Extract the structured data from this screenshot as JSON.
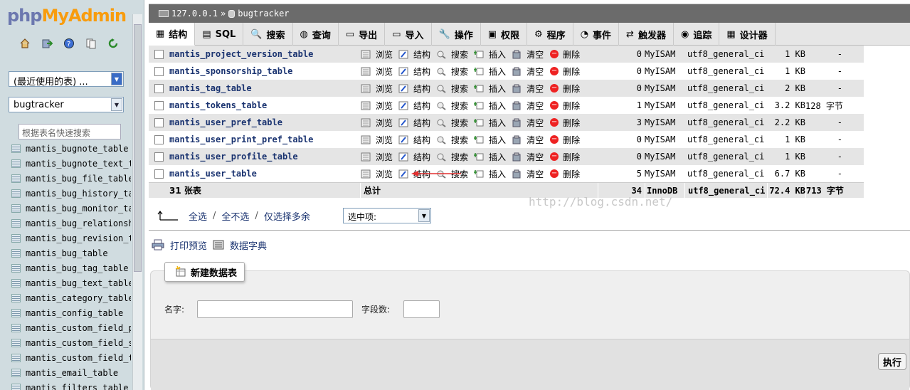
{
  "logo": {
    "part1": "php",
    "part2": "MyAdmin"
  },
  "sidebar": {
    "recent_select": "(最近使用的表) ...",
    "db_select": "bugtracker",
    "filter_placeholder": "根据表名快速搜索",
    "tables": [
      "mantis_bugnote_table",
      "mantis_bugnote_text_table",
      "mantis_bug_file_table",
      "mantis_bug_history_table",
      "mantis_bug_monitor_table",
      "mantis_bug_relationship_table",
      "mantis_bug_revision_table",
      "mantis_bug_table",
      "mantis_bug_tag_table",
      "mantis_bug_text_table",
      "mantis_category_table",
      "mantis_config_table",
      "mantis_custom_field_project_table",
      "mantis_custom_field_string_table",
      "mantis_custom_field_table",
      "mantis_email_table",
      "mantis_filters_table"
    ]
  },
  "breadcrumb": {
    "server": "127.0.0.1",
    "sep": "»",
    "database": "bugtracker"
  },
  "tabs": [
    "结构",
    "SQL",
    "搜索",
    "查询",
    "导出",
    "导入",
    "操作",
    "权限",
    "程序",
    "事件",
    "触发器",
    "追踪",
    "设计器"
  ],
  "actions": [
    "浏览",
    "结构",
    "搜索",
    "插入",
    "清空",
    "删除"
  ],
  "tables": [
    {
      "name": "mantis_project_version_table",
      "rows": "0",
      "engine": "MyISAM",
      "collation": "utf8_general_ci",
      "size": "1 KB",
      "overhead": "-"
    },
    {
      "name": "mantis_sponsorship_table",
      "rows": "0",
      "engine": "MyISAM",
      "collation": "utf8_general_ci",
      "size": "1 KB",
      "overhead": "-"
    },
    {
      "name": "mantis_tag_table",
      "rows": "0",
      "engine": "MyISAM",
      "collation": "utf8_general_ci",
      "size": "2 KB",
      "overhead": "-"
    },
    {
      "name": "mantis_tokens_table",
      "rows": "1",
      "engine": "MyISAM",
      "collation": "utf8_general_ci",
      "size": "3.2 KB",
      "overhead": "128 字节"
    },
    {
      "name": "mantis_user_pref_table",
      "rows": "3",
      "engine": "MyISAM",
      "collation": "utf8_general_ci",
      "size": "2.2 KB",
      "overhead": "-"
    },
    {
      "name": "mantis_user_print_pref_table",
      "rows": "0",
      "engine": "MyISAM",
      "collation": "utf8_general_ci",
      "size": "1 KB",
      "overhead": "-"
    },
    {
      "name": "mantis_user_profile_table",
      "rows": "0",
      "engine": "MyISAM",
      "collation": "utf8_general_ci",
      "size": "1 KB",
      "overhead": "-"
    },
    {
      "name": "mantis_user_table",
      "rows": "5",
      "engine": "MyISAM",
      "collation": "utf8_general_ci",
      "size": "6.7 KB",
      "overhead": "-"
    }
  ],
  "totals": {
    "count": "31 张表",
    "label": "总计",
    "rows": "34",
    "engine": "InnoDB",
    "collation": "utf8_general_ci",
    "size": "72.4 KB",
    "overhead": "713 字节"
  },
  "selection": {
    "check_all": "全选",
    "uncheck_all": "全不选",
    "check_overhead": "仅选择多余",
    "with_selected": "选中项:"
  },
  "watermark": "http://blog.csdn.net/",
  "print": {
    "preview": "打印预览",
    "dictionary": "数据字典"
  },
  "create_table": {
    "legend": "新建数据表",
    "name_label": "名字:",
    "columns_label": "字段数:",
    "go": "执行"
  },
  "colors": {
    "link": "#1a3370",
    "row_alt": "#e5e5e5",
    "breadcrumb_bg": "#6b6b6b",
    "annotation_arrow": "#e23030"
  }
}
